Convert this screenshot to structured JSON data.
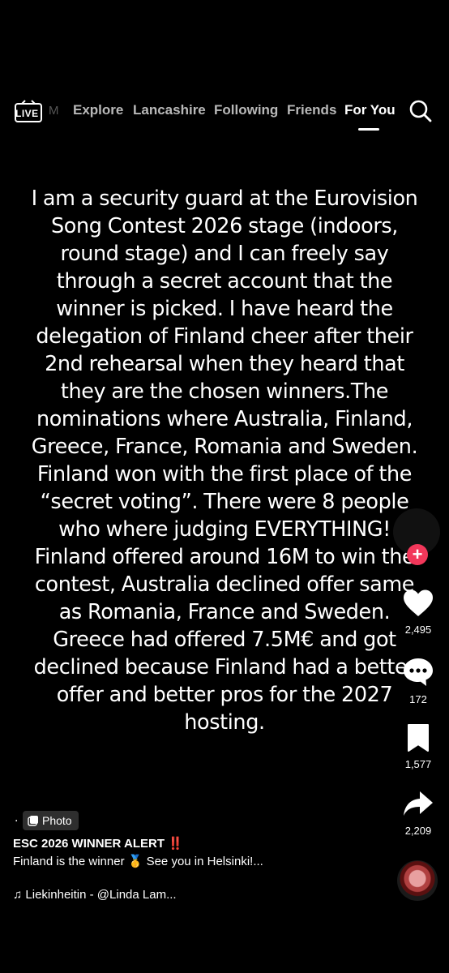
{
  "nav": {
    "live_label": "LIVE",
    "faded_label": "M",
    "tabs": [
      {
        "label": "Explore"
      },
      {
        "label": "Lancashire"
      },
      {
        "label": "Following"
      },
      {
        "label": "Friends"
      },
      {
        "label": "For You"
      }
    ],
    "active_tab": "For You"
  },
  "post": {
    "text": "I am a security guard at the Eurovision Song Contest 2026 stage (indoors, round stage) and I can freely say through a secret account that the winner is picked. I have heard the delegation of Finland cheer after their 2nd rehearsal when they heard that they are the chosen winners.The nominations where Australia, Finland, Greece, France, Romania and Sweden. Finland won with the first place of the “secret voting”. There were 8 people who where judging EVERYTHING! Finland offered around 16M to win the contest, Australia declined offer same as Romania, France and Sweden. Greece had offered 7.5M€ and got declined because Finland had a better offer and better pros for the 2027 hosting."
  },
  "actions": {
    "follow_symbol": "+",
    "likes": "2,495",
    "comments": "172",
    "saves": "1,577",
    "shares": "2,209"
  },
  "footer": {
    "dot": ".",
    "photo_badge": "Photo",
    "caption_title": "ESC 2026 WINNER ALERT ‼️",
    "caption_body": "Finland is the winner 🥇 See you in Helsinki!...",
    "music": "♫ Liekinheitin - @Linda Lam..."
  },
  "colors": {
    "background": "#000000",
    "follow_red": "#f2375a",
    "text": "#ffffff"
  }
}
